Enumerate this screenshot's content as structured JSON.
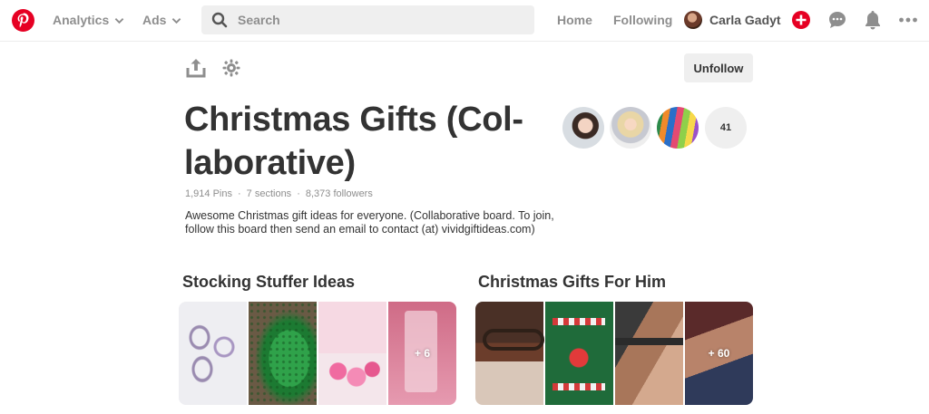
{
  "nav": {
    "analytics_label": "Analytics",
    "ads_label": "Ads",
    "search_placeholder": "Search",
    "home_label": "Home",
    "following_label": "Following",
    "profile_name": "Carla Gadyt"
  },
  "board": {
    "unfollow_label": "Unfollow",
    "title": "Christmas Gifts (Col-laborative)",
    "stats": {
      "pins": "1,914 Pins",
      "sections": "7 sections",
      "followers": "8,373 followers",
      "separator": "·"
    },
    "description": "Awesome Christmas gift ideas for everyone. (Collaborative board. To join, follow this board then send an email to contact (at) vividgiftideas.com)",
    "collaborator_count": "41"
  },
  "sections": [
    {
      "title": "Stocking Stuffer Ideas",
      "more_count": "+ 6"
    },
    {
      "title": "Christmas Gifts For Him",
      "more_count": "+ 60"
    }
  ],
  "colors": {
    "brand": "#e60023",
    "nav_text": "#8e8e8e",
    "heading": "#333333",
    "button_bg": "#efefef"
  }
}
